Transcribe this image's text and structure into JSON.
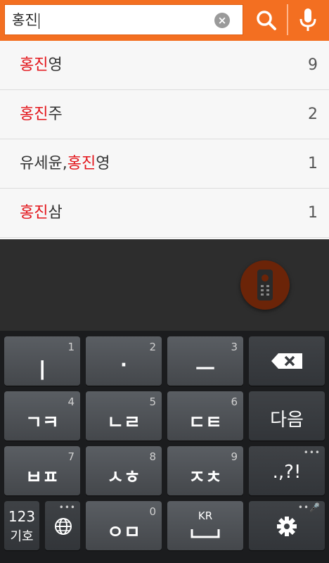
{
  "search": {
    "query": "홍진"
  },
  "suggestions": [
    {
      "highlight": "홍진",
      "pre": "",
      "rest": "영",
      "count": "9"
    },
    {
      "highlight": "홍진",
      "pre": "",
      "rest": "주",
      "count": "2"
    },
    {
      "highlight": "홍진",
      "pre": "유세윤,",
      "rest": "영",
      "count": "1"
    },
    {
      "highlight": "홍진",
      "pre": "",
      "rest": "삼",
      "count": "1"
    }
  ],
  "keyboard": {
    "k1": "ㅣ",
    "k1n": "1",
    "k2": "·",
    "k2n": "2",
    "k3": "ㅡ",
    "k3n": "3",
    "k4": "ㄱㅋ",
    "k4n": "4",
    "k5": "ㄴㄹ",
    "k5n": "5",
    "k6": "ㄷㅌ",
    "k6n": "6",
    "next": "다음",
    "k7": "ㅂㅍ",
    "k7n": "7",
    "k8": "ㅅㅎ",
    "k8n": "8",
    "k9": "ㅈㅊ",
    "k9n": "9",
    "punct": ".,?!",
    "sym1": "123",
    "sym2": "기호",
    "k0": "ㅇㅁ",
    "k0n": "0",
    "space_label": "KR"
  },
  "colors": {
    "accent": "#f36f21",
    "highlight": "#e3141a"
  }
}
